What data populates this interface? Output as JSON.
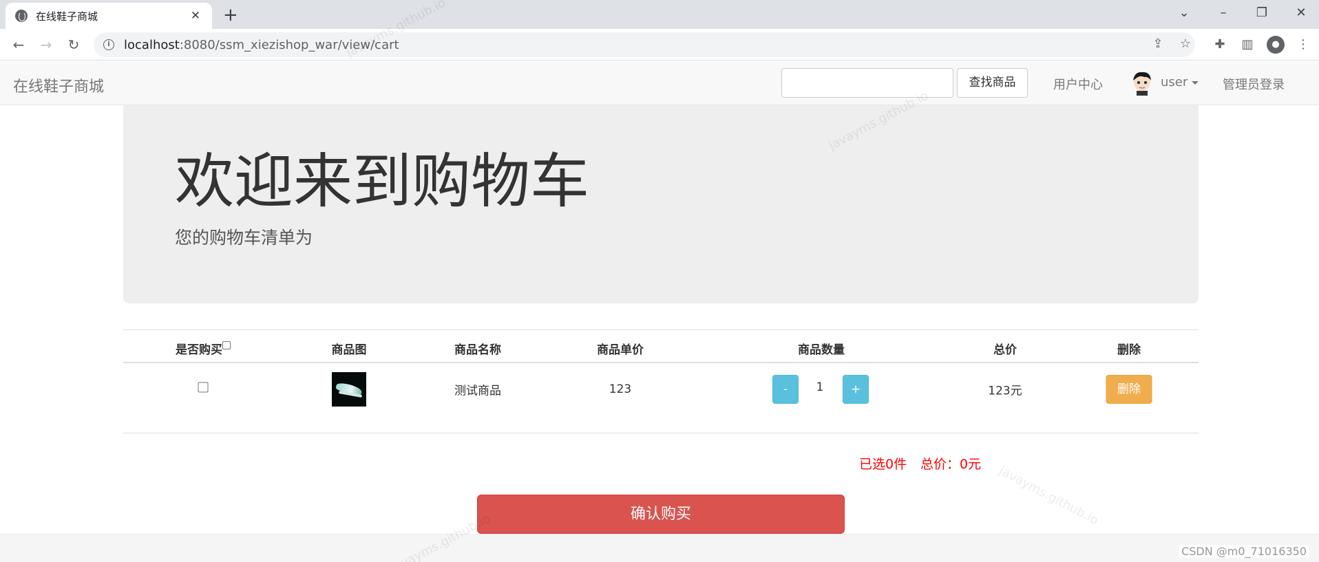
{
  "browser": {
    "tab_title": "在线鞋子商城",
    "url_host": "localhost",
    "url_path": ":8080/ssm_xiezishop_war/view/cart"
  },
  "navbar": {
    "brand": "在线鞋子商城",
    "search_placeholder": "",
    "search_button": "查找商品",
    "user_center": "用户中心",
    "username": "user",
    "admin_login": "管理员登录"
  },
  "jumbotron": {
    "title": "欢迎来到购物车",
    "subtitle": "您的购物车清单为"
  },
  "cart": {
    "columns": [
      "是否购买",
      "商品图",
      "商品名称",
      "商品单价",
      "商品数量",
      "总价",
      "删除"
    ],
    "items": [
      {
        "name": "测试商品",
        "unit_price": "123",
        "quantity": "1",
        "total": "123元",
        "minus_label": "-",
        "plus_label": "+",
        "delete_label": "删除"
      }
    ],
    "summary_selected": "已选0件",
    "summary_total": "总价：0元",
    "confirm_button": "确认购买"
  },
  "watermark_text": "javayms.github.io",
  "credit": "CSDN @m0_71016350"
}
